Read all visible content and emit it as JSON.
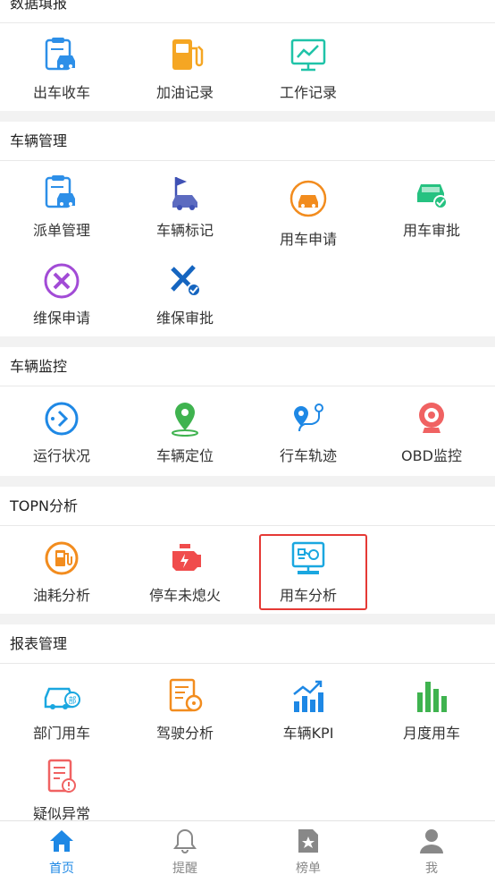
{
  "sections": [
    {
      "title": "数据填报",
      "items": [
        "出车收车",
        "加油记录",
        "工作记录"
      ]
    },
    {
      "title": "车辆管理",
      "items": [
        "派单管理",
        "车辆标记",
        "用车申请",
        "用车审批",
        "维保申请",
        "维保审批"
      ]
    },
    {
      "title": "车辆监控",
      "items": [
        "运行状况",
        "车辆定位",
        "行车轨迹",
        "OBD监控"
      ]
    },
    {
      "title": "TOPN分析",
      "items": [
        "油耗分析",
        "停车未熄火",
        "用车分析"
      ]
    },
    {
      "title": "报表管理",
      "items": [
        "部门用车",
        "驾驶分析",
        "车辆KPI",
        "月度用车",
        "疑似异常"
      ]
    }
  ],
  "tabbar": {
    "items": [
      "首页",
      "提醒",
      "榜单",
      "我"
    ],
    "active_index": 0
  },
  "colors": {
    "accent": "#1e88e5",
    "selection": "#e53935",
    "inactive": "#888888"
  }
}
